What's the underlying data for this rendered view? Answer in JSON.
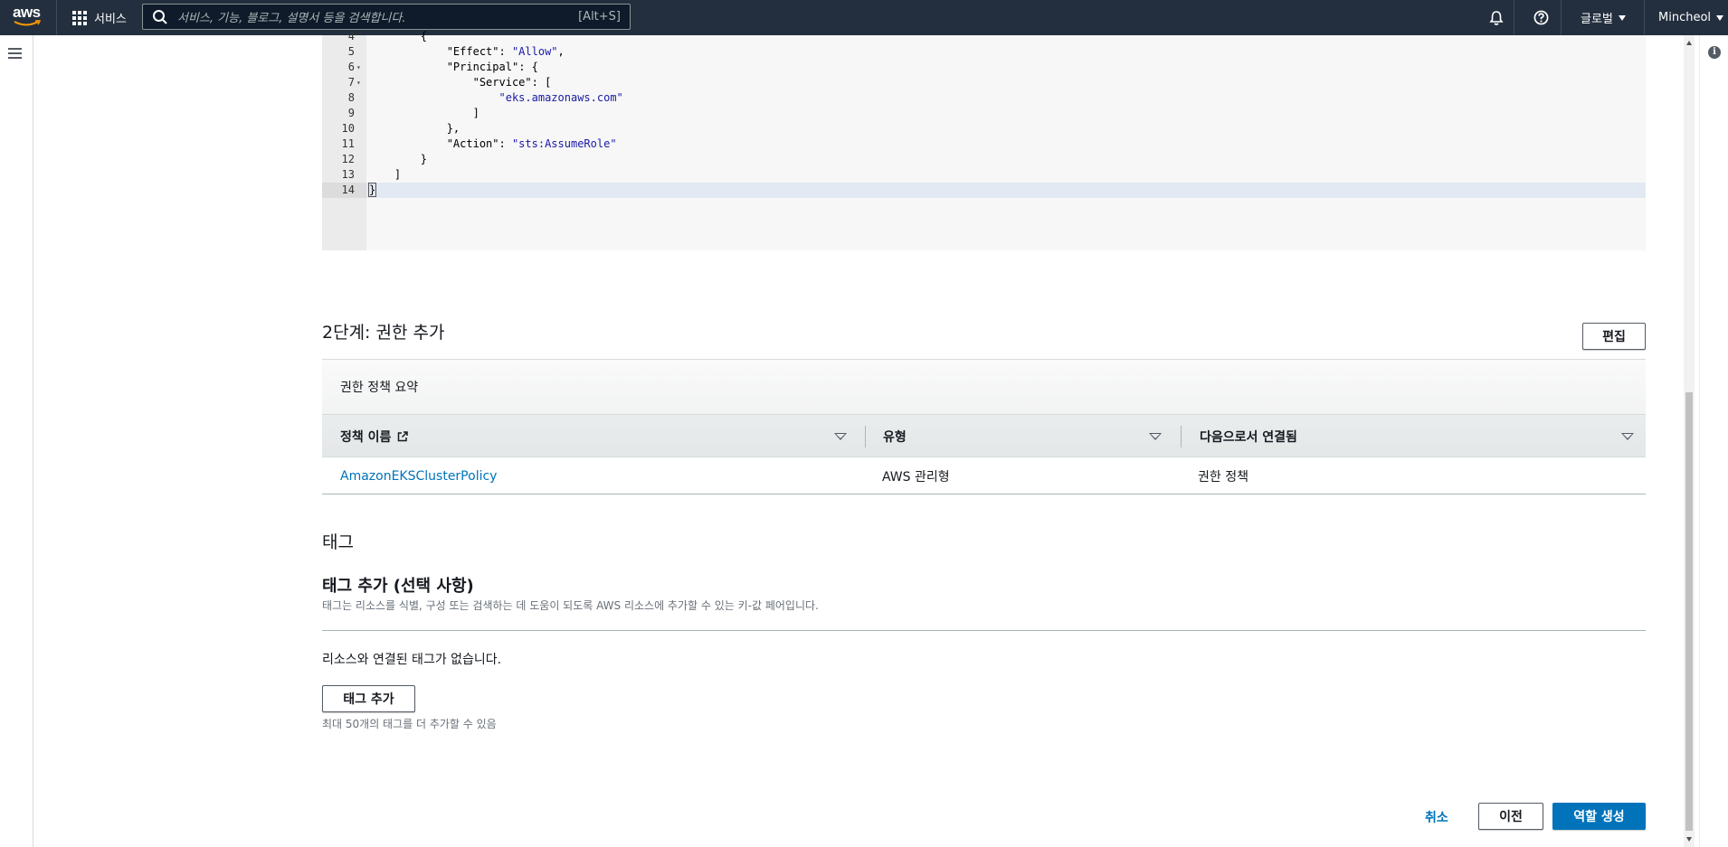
{
  "topnav": {
    "logo_text": "aws",
    "services_label": "서비스",
    "search_placeholder": "서비스, 기능, 블로그, 설명서 등을 검색합니다.",
    "search_shortcut": "[Alt+S]",
    "region_label": "글로벌",
    "user_label": "Mincheol"
  },
  "editor": {
    "lines": [
      {
        "n": "4",
        "text": "        {",
        "fold": ""
      },
      {
        "n": "5",
        "text": "            \"Effect\": \"Allow\",",
        "fold": ""
      },
      {
        "n": "6",
        "text": "            \"Principal\": {",
        "fold": "▾"
      },
      {
        "n": "7",
        "text": "                \"Service\": [",
        "fold": "▾"
      },
      {
        "n": "8",
        "text": "                    \"eks.amazonaws.com\"",
        "fold": ""
      },
      {
        "n": "9",
        "text": "                ]",
        "fold": ""
      },
      {
        "n": "10",
        "text": "            },",
        "fold": ""
      },
      {
        "n": "11",
        "text": "            \"Action\": \"sts:AssumeRole\"",
        "fold": ""
      },
      {
        "n": "12",
        "text": "        }",
        "fold": ""
      },
      {
        "n": "13",
        "text": "    ]",
        "fold": ""
      },
      {
        "n": "14",
        "text": "}",
        "fold": ""
      }
    ]
  },
  "step2": {
    "title": "2단계: 권한 추가",
    "edit_label": "편집",
    "summary_label": "권한 정책 요약",
    "columns": [
      "정책 이름",
      "유형",
      "다음으로서 연결됨"
    ],
    "rows": [
      {
        "name": "AmazonEKSClusterPolicy",
        "type": "AWS 관리형",
        "attached_as": "권한 정책"
      }
    ]
  },
  "tags": {
    "title": "태그",
    "subtitle": "태그 추가 (선택 사항)",
    "description": "태그는 리소스를 식별, 구성 또는 검색하는 데 도움이 되도록 AWS 리소스에 추가할 수 있는 키-값 페어입니다.",
    "empty_text": "리소스와 연결된 태그가 없습니다.",
    "add_label": "태그 추가",
    "limit_text": "최대 50개의 태그를 더 추가할 수 있음"
  },
  "footer": {
    "cancel_label": "취소",
    "previous_label": "이전",
    "create_label": "역할 생성"
  },
  "colors": {
    "nav_bg": "#232f3e",
    "link": "#0073bb",
    "primary": "#0073bb"
  }
}
